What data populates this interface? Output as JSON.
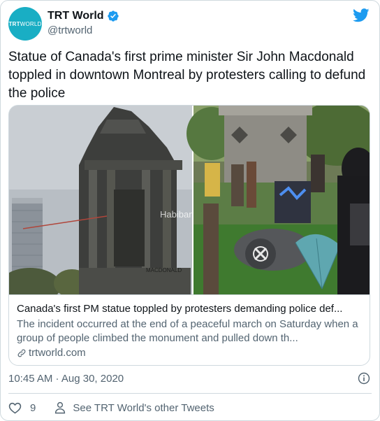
{
  "account": {
    "display_name": "TRT World",
    "handle": "@trtworld",
    "avatar_text": "TRT",
    "avatar_text2": "WORLD",
    "brand_color": "#19aec4",
    "verified_color": "#1d9bf0"
  },
  "tweet": {
    "text": "Statue of Canada's first prime minister Sir John Macdonald toppled in downtown Montreal by protesters calling to defund the police"
  },
  "link_card": {
    "title": "Canada's first PM statue toppled by protesters demanding police def...",
    "description": "The incident occurred at the end of a peaceful march on Saturday when a group of people climbed the monument and pulled down th...",
    "domain": "trtworld.com",
    "image_watermark": "Habiban",
    "plaque_text": "MACDONALD"
  },
  "meta": {
    "timestamp": "10:45 AM · Aug 30, 2020"
  },
  "actions": {
    "like_count": "9",
    "see_more_label": "See TRT World's other Tweets"
  },
  "icons": {
    "verified": "verified-badge-icon",
    "bird": "twitter-bird-icon",
    "link": "link-icon",
    "info": "info-icon",
    "heart": "heart-icon",
    "person": "person-icon"
  }
}
